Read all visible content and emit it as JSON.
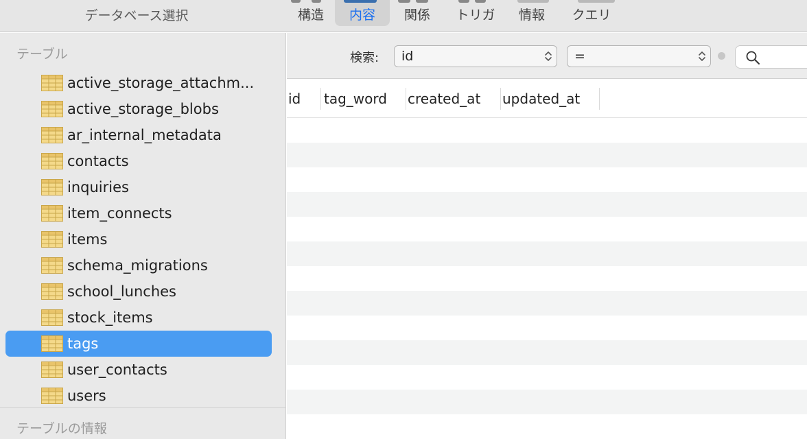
{
  "toolbar": {
    "db_select_label": "データベース選択",
    "tabs": [
      {
        "label": "構造",
        "active": false
      },
      {
        "label": "内容",
        "active": true
      },
      {
        "label": "関係",
        "active": false
      },
      {
        "label": "トリガ",
        "active": false
      },
      {
        "label": "情報",
        "active": false
      },
      {
        "label": "クエリ",
        "active": false
      }
    ]
  },
  "sidebar": {
    "tables_section_title": "テーブル",
    "info_section_title": "テーブルの情報",
    "tables": [
      {
        "name": "active_storage_attachm..."
      },
      {
        "name": "active_storage_blobs"
      },
      {
        "name": "ar_internal_metadata"
      },
      {
        "name": "contacts"
      },
      {
        "name": "inquiries"
      },
      {
        "name": "item_connects"
      },
      {
        "name": "items"
      },
      {
        "name": "schema_migrations"
      },
      {
        "name": "school_lunches"
      },
      {
        "name": "stock_items"
      },
      {
        "name": "tags",
        "selected": true
      },
      {
        "name": "user_contacts"
      },
      {
        "name": "users"
      }
    ]
  },
  "filter": {
    "search_label": "検索:",
    "field_value": "id",
    "operator_value": "=",
    "search_text": ""
  },
  "grid": {
    "columns": [
      "id",
      "tag_word",
      "created_at",
      "updated_at"
    ]
  },
  "colors": {
    "selection": "#4a9cf2",
    "active_tab_text": "#1a6ff0",
    "row_alt": "#f3f4f4",
    "table_icon": "#f2d27a"
  }
}
